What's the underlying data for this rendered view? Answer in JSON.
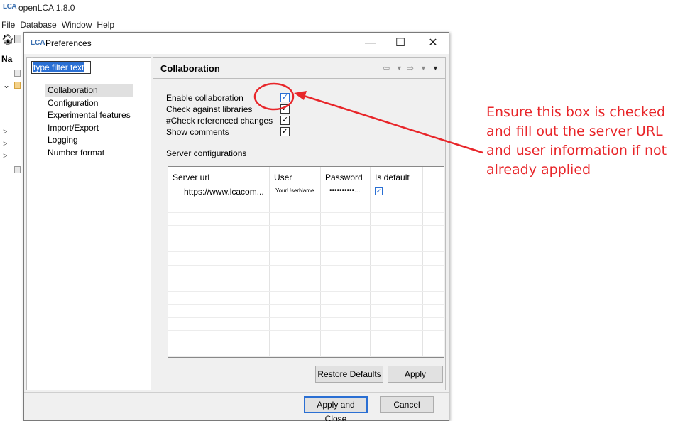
{
  "app": {
    "logo": "LCA",
    "title": "openLCA 1.8.0",
    "menu": [
      "File",
      "Database",
      "Window",
      "Help"
    ],
    "nav_label": "Na"
  },
  "dialog": {
    "logo": "LCA",
    "title": "Preferences",
    "filter": {
      "value": "type filter text"
    },
    "pages": [
      "Collaboration",
      "Configuration",
      "Experimental features",
      "Import/Export",
      "Logging",
      "Number format"
    ],
    "selected_page": "Collaboration",
    "panel_title": "Collaboration",
    "checkboxes": [
      {
        "label": "Enable collaboration",
        "checked": true
      },
      {
        "label": "Check against libraries",
        "checked": true
      },
      {
        "label": "#Check referenced changes",
        "checked": true
      },
      {
        "label": "Show comments",
        "checked": true
      }
    ],
    "server_configurations_label": "Server configurations",
    "table": {
      "columns": [
        "Server url",
        "User",
        "Password",
        "Is default"
      ],
      "rows": [
        {
          "url": "https://www.lcacom...",
          "user": "YourUserName",
          "password": "••••••••••...",
          "is_default": true
        }
      ]
    },
    "buttons": {
      "restore_defaults": "Restore Defaults",
      "apply": "Apply",
      "apply_and_close": "Apply and Close",
      "cancel": "Cancel"
    }
  },
  "annotation": {
    "text": "Ensure this box is checked and fill out the server URL and user information if not already applied",
    "color": "#e8262a"
  }
}
